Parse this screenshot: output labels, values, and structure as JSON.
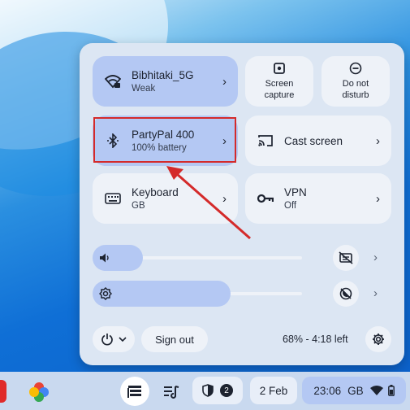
{
  "quick_settings": {
    "network": {
      "name": "Bibhitaki_5G",
      "status": "Weak"
    },
    "screen_capture": {
      "line1": "Screen",
      "line2": "capture"
    },
    "do_not_disturb": {
      "line1": "Do not",
      "line2": "disturb"
    },
    "bluetooth": {
      "name": "PartyPal 400",
      "status": "100% battery"
    },
    "cast": {
      "label": "Cast screen"
    },
    "keyboard": {
      "name": "Keyboard",
      "layout": "GB"
    },
    "vpn": {
      "name": "VPN",
      "status": "Off"
    },
    "volume_level": 0.24,
    "brightness_level": 0.66,
    "sign_out": "Sign out",
    "battery": "68% - 4:18 left"
  },
  "shelf": {
    "notification_count": "2",
    "date": "2 Feb",
    "time": "23:06",
    "locale": "GB"
  },
  "colors": {
    "accent": "#b4c8f3",
    "panel": "#dce6f3",
    "tile_off": "#eef2f8",
    "highlight": "#d42a2a",
    "arrow": "#d42a2a"
  }
}
